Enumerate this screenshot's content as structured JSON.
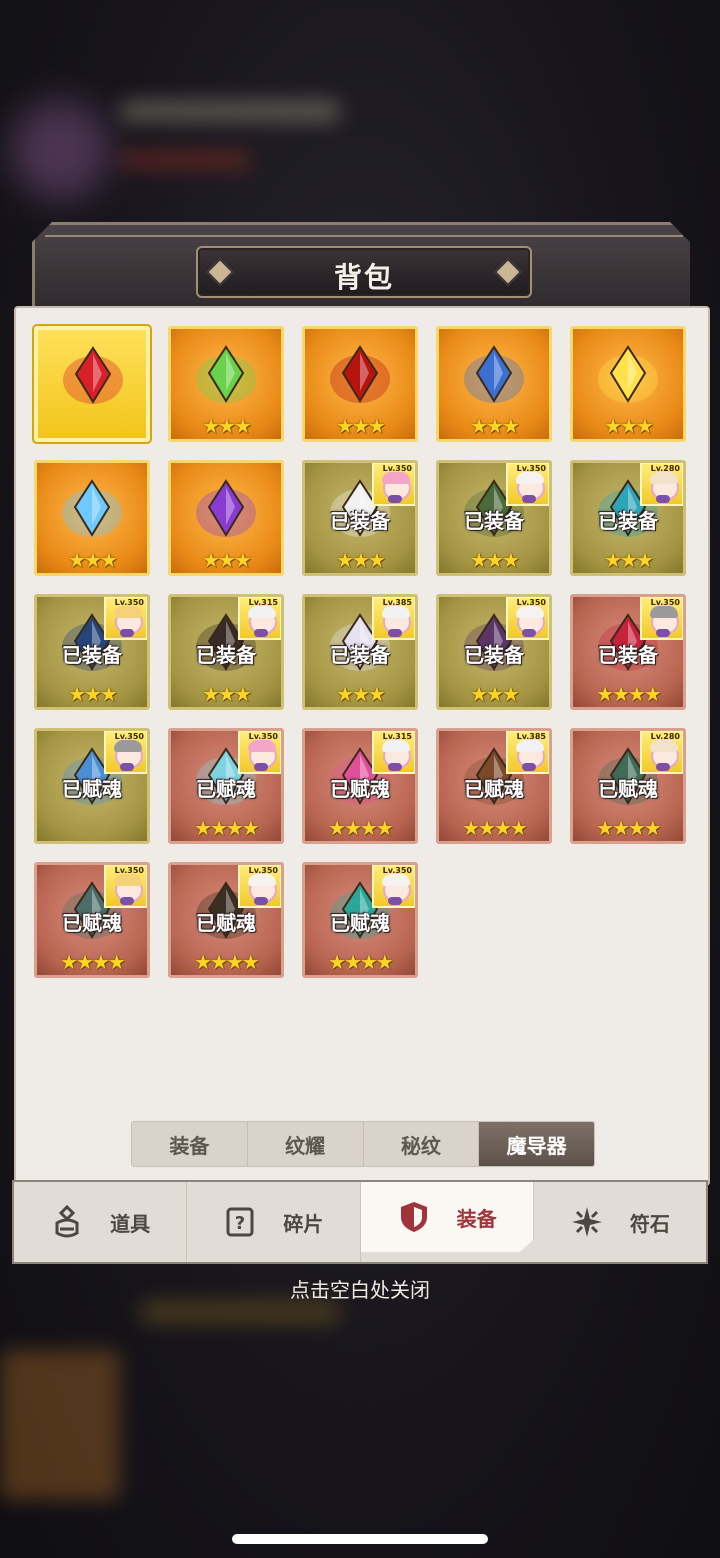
{
  "panel": {
    "title": "背包"
  },
  "items": [
    {
      "bg": "gold",
      "icon": "crown-icon",
      "color": "#d91f2a",
      "stars": "",
      "status": "",
      "hero": null
    },
    {
      "bg": "orange",
      "icon": "crystal-icon",
      "color": "#6ad24a",
      "stars": "★★★",
      "status": "",
      "hero": null
    },
    {
      "bg": "orange",
      "icon": "fire-orb-icon",
      "color": "#b8140f",
      "stars": "★★★",
      "status": "",
      "hero": null
    },
    {
      "bg": "orange",
      "icon": "dark-wing-gem-icon",
      "color": "#3b6fd1",
      "stars": "★★★",
      "status": "",
      "hero": null
    },
    {
      "bg": "orange",
      "icon": "winged-star-icon",
      "color": "#ffe14a",
      "stars": "★★★",
      "status": "",
      "hero": null
    },
    {
      "bg": "orange",
      "icon": "water-drop-icon",
      "color": "#6ec9ff",
      "stars": "★★★",
      "status": "",
      "hero": null
    },
    {
      "bg": "orange",
      "icon": "dragon-gem-icon",
      "color": "#8a3bd1",
      "stars": "★★★",
      "status": "",
      "hero": null
    },
    {
      "bg": "olive",
      "icon": "white-wing-icon",
      "color": "#f1f1f1",
      "stars": "★★★",
      "status": "已装备",
      "hero": {
        "lv": "Lv.350",
        "hair": "#f4a6c9"
      }
    },
    {
      "bg": "olive",
      "icon": "skull-icon",
      "color": "#4b6b3a",
      "stars": "★★★",
      "status": "已装备",
      "hero": {
        "lv": "Lv.350",
        "hair": "#f6f2ef"
      }
    },
    {
      "bg": "olive",
      "icon": "harp-icon",
      "color": "#2ca5b8",
      "stars": "★★★",
      "status": "已装备",
      "hero": {
        "lv": "Lv.280",
        "hair": "#f1e3c9"
      }
    },
    {
      "bg": "olive",
      "icon": "blue-star-icon",
      "color": "#26457a",
      "stars": "★★★",
      "status": "已装备",
      "hero": {
        "lv": "Lv.350",
        "hair": "#f7d17a"
      }
    },
    {
      "bg": "olive",
      "icon": "dark-ring-icon",
      "color": "#3a2a25",
      "stars": "★★★",
      "status": "已装备",
      "hero": {
        "lv": "Lv.315",
        "hair": "#f2f2f2"
      }
    },
    {
      "bg": "olive",
      "icon": "silver-star-icon",
      "color": "#e5e1f0",
      "stars": "★★★",
      "status": "已装备",
      "hero": {
        "lv": "Lv.385",
        "hair": "#f2f2f2"
      }
    },
    {
      "bg": "olive",
      "icon": "purple-horn-icon",
      "color": "#5c3568",
      "stars": "★★★",
      "status": "已装备",
      "hero": {
        "lv": "Lv.350",
        "hair": "#f6f2ef"
      }
    },
    {
      "bg": "red",
      "icon": "red-ring-icon",
      "color": "#c8223c",
      "stars": "★★★★",
      "status": "已装备",
      "hero": {
        "lv": "Lv.350",
        "hair": "#9a9a9a"
      }
    },
    {
      "bg": "olive",
      "icon": "blue-spirit-icon",
      "color": "#4a8fd6",
      "stars": "",
      "status": "已赋魂",
      "hero": {
        "lv": "Lv.350",
        "hair": "#9a9a9a"
      }
    },
    {
      "bg": "red",
      "icon": "ice-star-icon",
      "color": "#7dd3e0",
      "stars": "★★★★",
      "status": "已赋魂",
      "hero": {
        "lv": "Lv.350",
        "hair": "#f4a6c9"
      }
    },
    {
      "bg": "red",
      "icon": "pink-star-icon",
      "color": "#e0509a",
      "stars": "★★★★",
      "status": "已赋魂",
      "hero": {
        "lv": "Lv.315",
        "hair": "#f2f2f2"
      }
    },
    {
      "bg": "red",
      "icon": "rune-ring-icon",
      "color": "#7a4a2a",
      "stars": "★★★★",
      "status": "已赋魂",
      "hero": {
        "lv": "Lv.385",
        "hair": "#f2f2f2"
      }
    },
    {
      "bg": "red",
      "icon": "lantern-icon",
      "color": "#3f6b59",
      "stars": "★★★★",
      "status": "已赋魂",
      "hero": {
        "lv": "Lv.280",
        "hair": "#f1e3c9"
      }
    },
    {
      "bg": "red",
      "icon": "hourglass-icon",
      "color": "#4a6d6a",
      "stars": "★★★★",
      "status": "已赋魂",
      "hero": {
        "lv": "Lv.350",
        "hair": "#f7d17a"
      }
    },
    {
      "bg": "red",
      "icon": "horned-mask-icon",
      "color": "#3a2f22",
      "stars": "★★★★",
      "status": "已赋魂",
      "hero": {
        "lv": "Lv.350",
        "hair": "#f6f2ef"
      }
    },
    {
      "bg": "red",
      "icon": "teal-ring-icon",
      "color": "#2aa69a",
      "stars": "★★★★",
      "status": "已赋魂",
      "hero": {
        "lv": "Lv.350",
        "hair": "#f6f2ef"
      }
    }
  ],
  "subtabs": [
    {
      "label": "装备",
      "active": false
    },
    {
      "label": "纹耀",
      "active": false
    },
    {
      "label": "秘纹",
      "active": false
    },
    {
      "label": "魔导器",
      "active": true
    }
  ],
  "bottom_tabs": [
    {
      "label": "道具",
      "icon": "potion-icon",
      "active": false
    },
    {
      "label": "碎片",
      "icon": "question-box-icon",
      "active": false
    },
    {
      "label": "装备",
      "icon": "shield-icon",
      "active": true
    },
    {
      "label": "符石",
      "icon": "sparkle-icon",
      "active": false
    }
  ],
  "close_hint": "点击空白处关闭"
}
